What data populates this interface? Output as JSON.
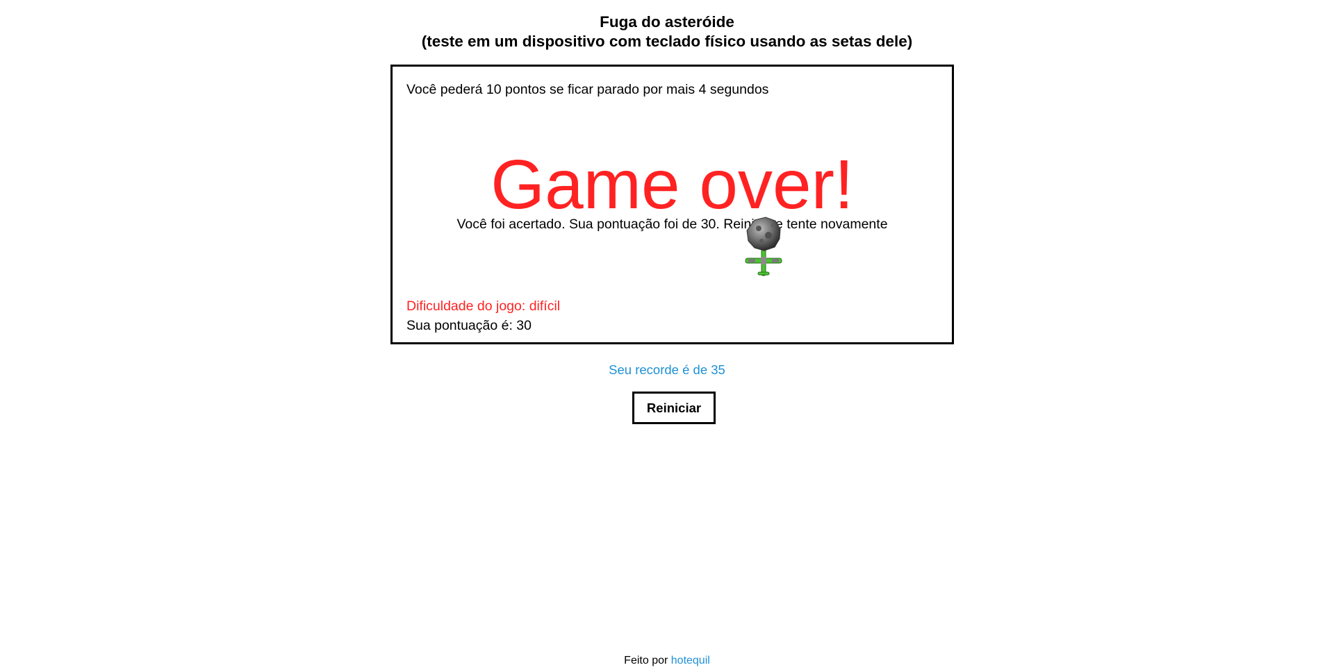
{
  "header": {
    "title": "Fuga do asteróide",
    "subtitle": "(teste em um dispositivo com teclado físico usando as setas dele)"
  },
  "game": {
    "penalty_warning": "Você pederá 10 pontos se ficar parado por mais 4 segundos",
    "game_over_title": "Game over!",
    "game_over_message": "Você foi acertado. Sua pontuação foi de 30. Reinicie e tente novamente",
    "difficulty": "Dificuldade do jogo: difícil",
    "score": "Sua pontuação é: 30",
    "sprites": {
      "asteroid_icon": "asteroid-icon",
      "ship_icon": "spaceship-icon"
    }
  },
  "record": "Seu recorde é de 35",
  "controls": {
    "restart_label": "Reiniciar"
  },
  "footer": {
    "made_by": "Feito por",
    "author": "hotequil"
  },
  "colors": {
    "danger": "#ff2222",
    "link": "#1e90d6",
    "text": "#000000",
    "ship_green": "#4cc233"
  }
}
